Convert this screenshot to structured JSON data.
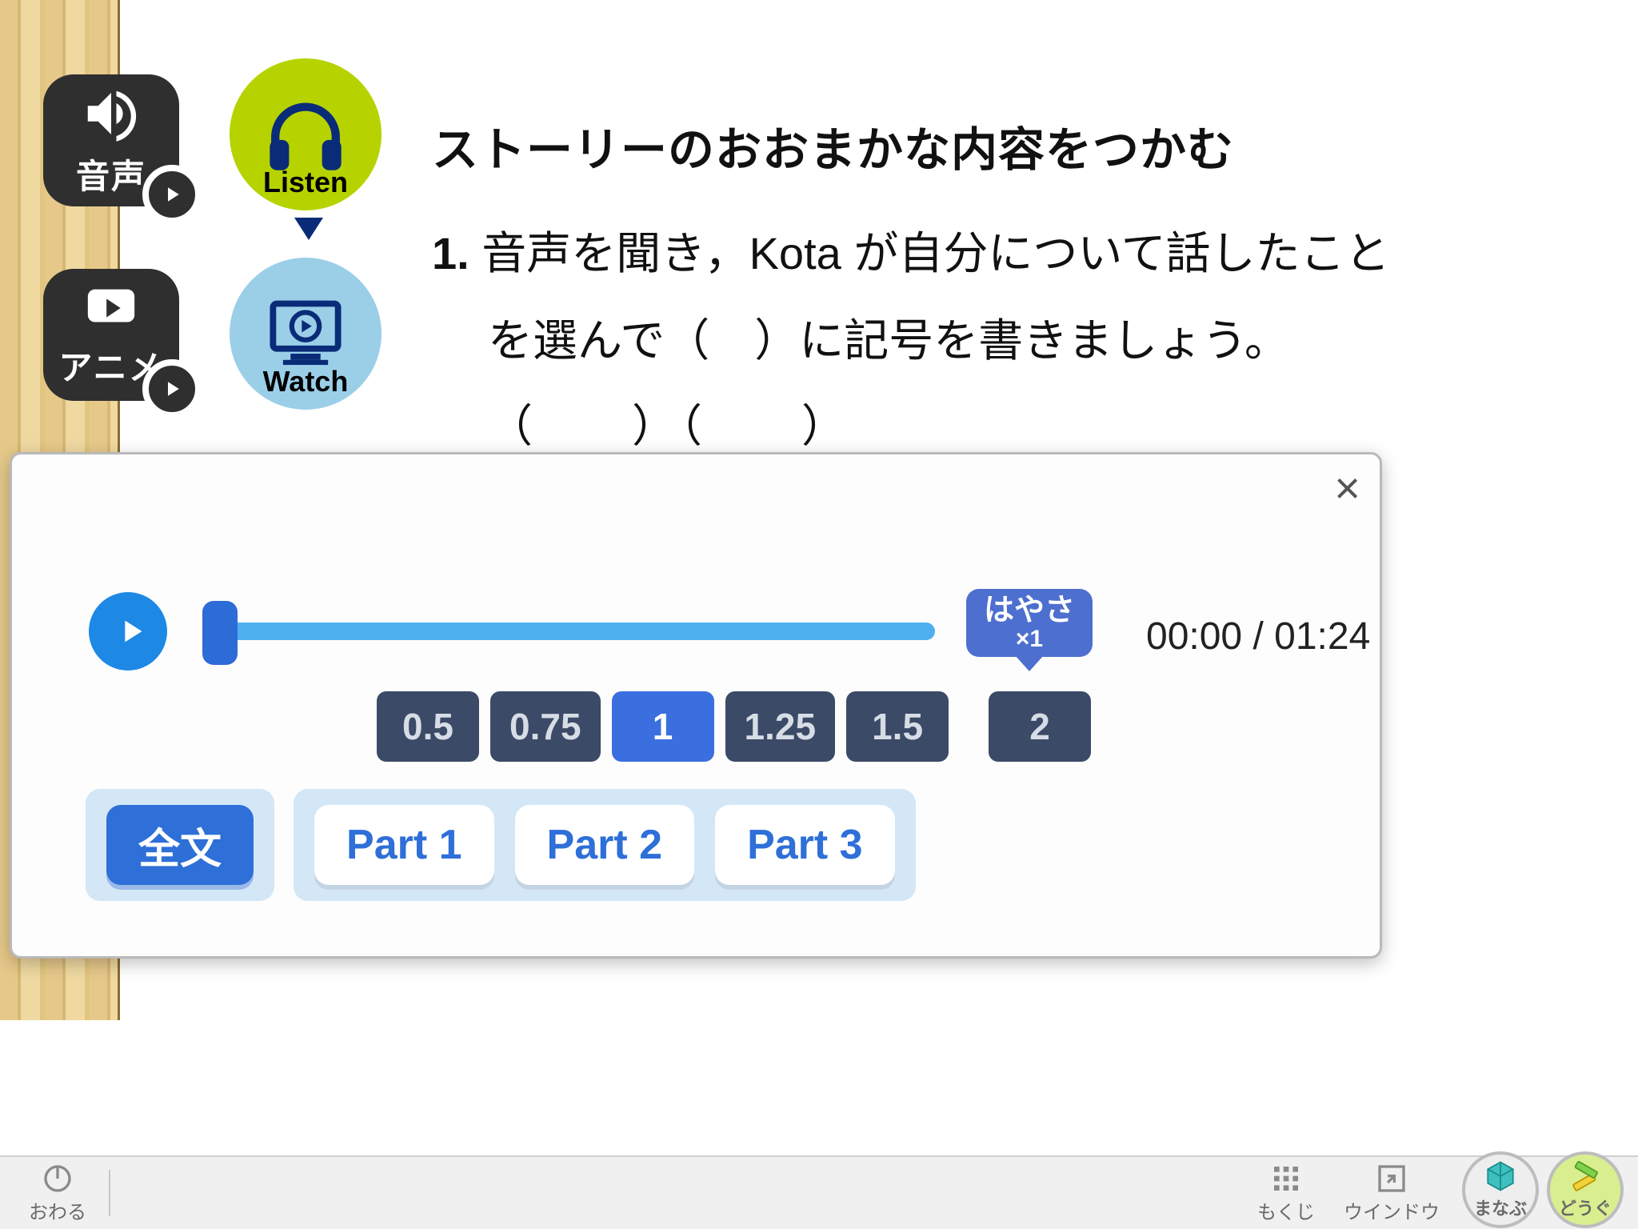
{
  "sidebar": {
    "audio_label": "音声",
    "anime_label": "アニメ",
    "listen_label": "Listen",
    "watch_label": "Watch"
  },
  "instruction": {
    "title": "ストーリーのおおまかな内容をつかむ",
    "num": "1.",
    "body_line1": "音声を聞き，Kota が自分について話したこと",
    "body_line2": "を選んで（　）に記号を書きましょう。",
    "parens": "（　　）（　　）"
  },
  "player": {
    "speed_label": "はやさ",
    "speed_value": "×1",
    "time_current": "00:00",
    "time_sep": " / ",
    "time_total": "01:24",
    "speeds": [
      "0.5",
      "0.75",
      "1",
      "1.25",
      "1.5",
      "2"
    ],
    "speed_active_index": 2,
    "segments": {
      "all": "全文",
      "parts": [
        "Part 1",
        "Part 2",
        "Part 3"
      ]
    }
  },
  "toolbar": {
    "end": "おわる",
    "toc": "もくじ",
    "window": "ウインドウ",
    "learn": "まなぶ",
    "tools": "どうぐ"
  }
}
